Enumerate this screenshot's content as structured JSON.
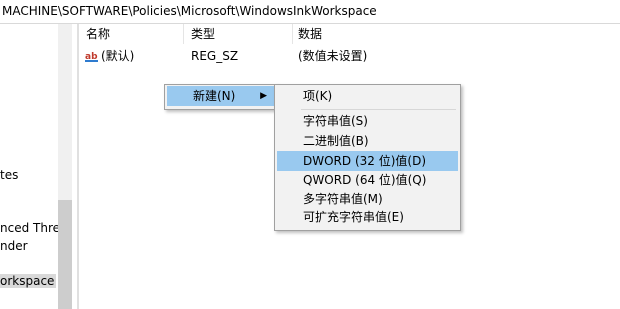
{
  "address": "MACHINE\\SOFTWARE\\Policies\\Microsoft\\WindowsInkWorkspace",
  "tree": {
    "items": [
      {
        "label": "tes"
      },
      {
        "label": "nced Threat"
      },
      {
        "label": "nder"
      },
      {
        "label": "orkspace",
        "selected": true
      }
    ]
  },
  "list": {
    "columns": [
      "名称",
      "类型",
      "数据"
    ],
    "rows": [
      {
        "name": "(默认)",
        "type": "REG_SZ",
        "data": "(数值未设置)"
      }
    ]
  },
  "context_menu": {
    "new_label": "新建(N)"
  },
  "submenu": {
    "items": [
      "项(K)",
      "字符串值(S)",
      "二进制值(B)",
      "DWORD (32 位)值(D)",
      "QWORD (64 位)值(Q)",
      "多字符串值(M)",
      "可扩充字符串值(E)"
    ],
    "highlighted": "DWORD (32 位)值(D)"
  },
  "colors": {
    "highlight": "#99c9ef",
    "menu_bg": "#f2f2f2"
  },
  "icons": {
    "value": "reg-string-icon",
    "submenu_arrow": "chevron-right-icon"
  }
}
